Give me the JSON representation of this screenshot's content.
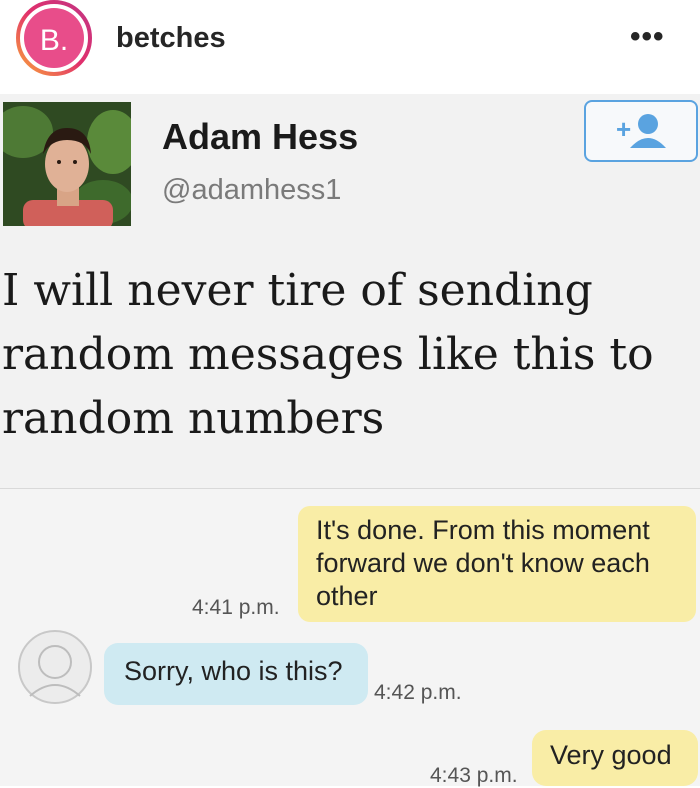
{
  "instagram": {
    "username": "betches",
    "more_label": "•••",
    "avatar_letter": "B."
  },
  "tweet": {
    "name": "Adam Hess",
    "handle": "@adamhess1",
    "text": "I will never tire of sending random messages like this to random numbers",
    "follow_icon": "add-user-icon"
  },
  "messages": [
    {
      "side": "right",
      "text": "It's done. From this moment forward we don't know each other",
      "time": "4:41 p.m."
    },
    {
      "side": "left",
      "text": "Sorry, who is this?",
      "time": "4:42 p.m."
    },
    {
      "side": "right",
      "text": "Very good",
      "time": "4:43 p.m."
    }
  ],
  "colors": {
    "ig_ring": "#e1306c",
    "outgoing_bubble": "#f9eda6",
    "incoming_bubble": "#cfeaf2",
    "follow_blue": "#5aa3e0"
  }
}
